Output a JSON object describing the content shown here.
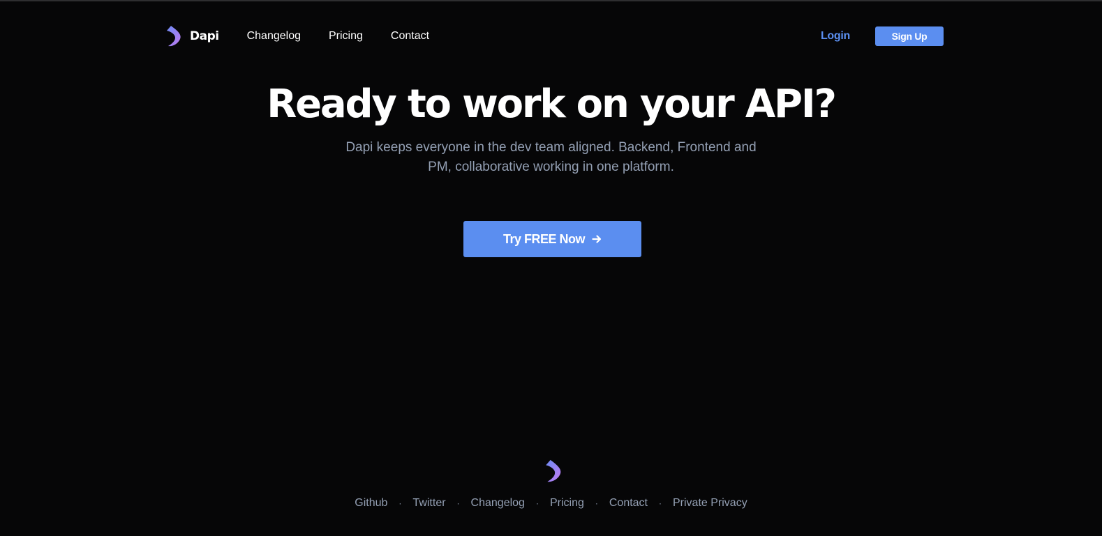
{
  "header": {
    "brand": "Dapi",
    "nav": [
      "Changelog",
      "Pricing",
      "Contact"
    ],
    "login": "Login",
    "signup": "Sign Up"
  },
  "hero": {
    "title": "Ready to work on your API?",
    "subtitle": "Dapi keeps everyone in the dev team aligned. Backend, Frontend and PM, collaborative working in one platform.",
    "cta": "Try FREE Now"
  },
  "footer": {
    "links": [
      "Github",
      "Twitter",
      "Changelog",
      "Pricing",
      "Contact",
      "Private Privacy"
    ],
    "separator": "·"
  },
  "colors": {
    "background": "#060607",
    "accent": "#5b8ef0",
    "logo_gradient": [
      "#6d8bf5",
      "#b87af0"
    ],
    "muted_text": "#94a0b4"
  },
  "icons": {
    "logo": "dapi-logo-icon",
    "cta_arrow": "arrow-right-icon"
  }
}
